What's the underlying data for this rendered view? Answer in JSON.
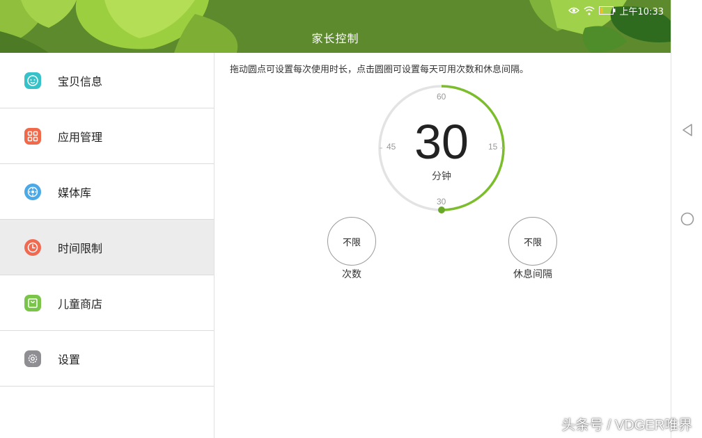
{
  "status_bar": {
    "time": "上午10:33",
    "icons": [
      "eye-icon",
      "wifi-icon",
      "battery-icon"
    ]
  },
  "header": {
    "title": "家长控制",
    "background_color": "#5c8a2c"
  },
  "sidebar": {
    "items": [
      {
        "label": "宝贝信息",
        "icon": "baby-face-icon",
        "color": "#35c2c8",
        "active": false
      },
      {
        "label": "应用管理",
        "icon": "apps-grid-icon",
        "color": "#f0694a",
        "active": false
      },
      {
        "label": "媒体库",
        "icon": "media-icon",
        "color": "#4aa9e6",
        "active": false
      },
      {
        "label": "时间限制",
        "icon": "clock-icon",
        "color": "#f06a52",
        "active": true
      },
      {
        "label": "儿童商店",
        "icon": "shopping-bag-icon",
        "color": "#7bc44a",
        "active": false
      },
      {
        "label": "设置",
        "icon": "gear-icon",
        "color": "#8e8e93",
        "active": false
      }
    ]
  },
  "main": {
    "hint": "拖动圆点可设置每次使用时长，点击圆圈可设置每天可用次数和休息间隔。",
    "dial": {
      "value": "30",
      "unit": "分钟",
      "ticks": {
        "top": "60",
        "right": "15",
        "bottom": "30",
        "left": "45"
      },
      "progress_fraction": 0.5,
      "accent_color": "#7bbd2a"
    },
    "count_button": {
      "value": "不限",
      "caption": "次数"
    },
    "interval_button": {
      "value": "不限",
      "caption": "休息间隔"
    }
  },
  "watermark": "头条号 / VDGER唯界"
}
